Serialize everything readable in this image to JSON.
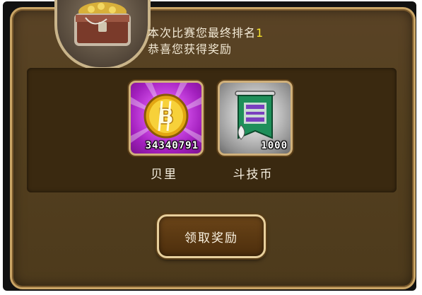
{
  "result": {
    "rank_prefix": "本次比赛您最终排名",
    "rank_value": "1",
    "congrats": "恭喜您获得奖励"
  },
  "rewards": [
    {
      "name": "贝里",
      "count": "34340791",
      "icon": "gold-coin-icon",
      "frame_color": "#c43ad8"
    },
    {
      "name": "斗技币",
      "count": "1000",
      "icon": "arena-banner-icon",
      "frame_color": "#a8a8a8"
    }
  ],
  "claim_button": {
    "label": "领取奖励"
  },
  "colors": {
    "panel": "#54401f",
    "border": "#caa566",
    "highlight": "#f7e32c"
  }
}
